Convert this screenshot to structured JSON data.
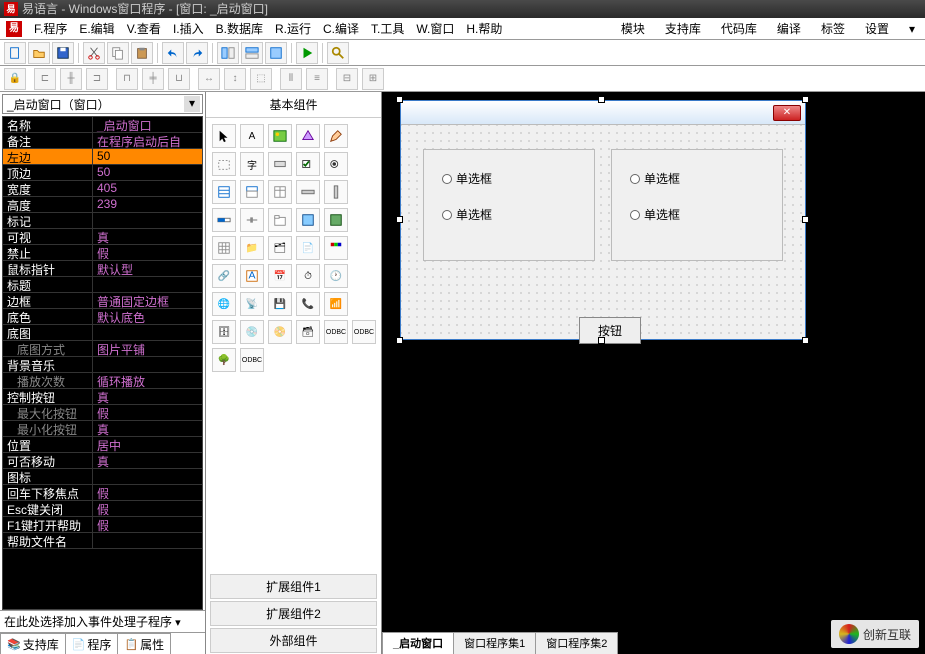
{
  "title_bar": "易语言 - Windows窗口程序 - [窗口: _启动窗口]",
  "menus": {
    "file": "F.程序",
    "edit": "E.编辑",
    "view": "V.查看",
    "insert": "I.插入",
    "database": "B.数据库",
    "run": "R.运行",
    "compile": "C.编译",
    "tools": "T.工具",
    "window": "W.窗口",
    "help": "H.帮助"
  },
  "right_menus": {
    "module": "模块",
    "support": "支持库",
    "codebase": "代码库",
    "compile": "编译",
    "tags": "标签",
    "settings": "设置"
  },
  "dropdown_sel": "_启动窗口（窗口）",
  "properties": [
    {
      "k": "名称",
      "v": "_启动窗口"
    },
    {
      "k": "备注",
      "v": "在程序启动后自"
    },
    {
      "k": "左边",
      "v": "50",
      "sel": true
    },
    {
      "k": "顶边",
      "v": "50"
    },
    {
      "k": "宽度",
      "v": "405"
    },
    {
      "k": "高度",
      "v": "239"
    },
    {
      "k": "标记",
      "v": ""
    },
    {
      "k": "可视",
      "v": "真"
    },
    {
      "k": "禁止",
      "v": "假"
    },
    {
      "k": "鼠标指针",
      "v": "默认型"
    },
    {
      "k": "标题",
      "v": ""
    },
    {
      "k": "边框",
      "v": "普通固定边框"
    },
    {
      "k": "底色",
      "v": "默认底色"
    },
    {
      "k": "底图",
      "v": ""
    },
    {
      "k": "底图方式",
      "v": "图片平铺",
      "indent": true
    },
    {
      "k": "背景音乐",
      "v": ""
    },
    {
      "k": "播放次数",
      "v": "循环播放",
      "indent": true
    },
    {
      "k": "控制按钮",
      "v": "真"
    },
    {
      "k": "最大化按钮",
      "v": "假",
      "indent": true
    },
    {
      "k": "最小化按钮",
      "v": "真",
      "indent": true
    },
    {
      "k": "位置",
      "v": "居中"
    },
    {
      "k": "可否移动",
      "v": "真"
    },
    {
      "k": "图标",
      "v": ""
    },
    {
      "k": "回车下移焦点",
      "v": "假"
    },
    {
      "k": "Esc键关闭",
      "v": "假"
    },
    {
      "k": "F1键打开帮助",
      "v": "假"
    },
    {
      "k": "帮助文件名",
      "v": ""
    }
  ],
  "prop_footer": "在此处选择加入事件处理子程序",
  "left_tabs": {
    "t1": "支持库",
    "t2": "程序",
    "t3": "属性"
  },
  "mid_header": "基本组件",
  "mid_footer": {
    "b1": "扩展组件1",
    "b2": "扩展组件2",
    "b3": "外部组件"
  },
  "form": {
    "radio1": "单选框",
    "radio2": "单选框",
    "radio3": "单选框",
    "radio4": "单选框",
    "button": "按钮"
  },
  "bottom_tabs": {
    "t1": "_启动窗口",
    "t2": "窗口程序集1",
    "t3": "窗口程序集2"
  },
  "watermark": "创新互联"
}
